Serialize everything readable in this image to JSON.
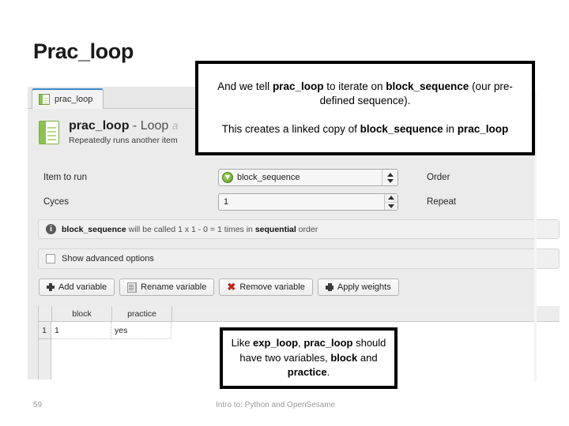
{
  "slide": {
    "title": "Prac_loop",
    "footer_number": "59",
    "footer_text": "Intro to: Python and OpenSesame"
  },
  "panel": {
    "tab": {
      "label": "prac_loop",
      "icon": "spreadsheet-icon"
    },
    "header": {
      "name": "prac_loop",
      "separator": " - ",
      "type": "Loop",
      "hint": "a",
      "description": "Repeatedly runs another item",
      "icon": "loop-spreadsheet-icon"
    },
    "fields": {
      "item_to_run_label": "Item to run",
      "item_to_run_value": "block_sequence",
      "item_to_run_icon": "sequence-icon",
      "order_label": "Order",
      "cycles_label": "Cyces",
      "cycles_value": "1",
      "repeat_label": "Repeat"
    },
    "info": {
      "icon": "info-icon",
      "prefix_bold": "block_sequence",
      "mid": " will be called 1 x 1 - 0 = 1 times in ",
      "order_bold": "sequential",
      "suffix": " order",
      "full_text": "block_sequence will be called 1 x 1 - 0 = 1 times in sequential order"
    },
    "advanced": {
      "checkbox_label": "Show advanced options",
      "checked": false
    },
    "buttons": [
      {
        "label": "Add variable",
        "icon": "plus-icon"
      },
      {
        "label": "Rename variable",
        "icon": "rename-icon"
      },
      {
        "label": "Remove variable",
        "icon": "x-icon"
      },
      {
        "label": "Apply weights",
        "icon": "plus-bold-icon"
      }
    ],
    "table": {
      "columns": [
        "block",
        "practice"
      ],
      "rows": [
        {
          "num": "1",
          "cells": [
            "1",
            "yes"
          ]
        }
      ]
    }
  },
  "callouts": {
    "top": {
      "line1_a": "And we tell ",
      "line1_b": "prac_loop",
      "line1_c": " to iterate on ",
      "line1_d": "block_sequence",
      "line1_e": " (our pre-defined sequence).",
      "line2_a": "This creates a linked copy of ",
      "line2_b": "block_sequence",
      "line2_c": " in ",
      "line2_d": "prac_loop"
    },
    "bottom": {
      "a": "Like ",
      "b": "exp_loop",
      "c": ", ",
      "d": "prac_loop",
      "e": " should have two variables, ",
      "f": "block",
      "g": " and ",
      "h": "practice",
      "i": "."
    }
  },
  "colors": {
    "accent_green": "#8cc152",
    "tab_highlight": "#3d87c8",
    "panel_bg": "#ebebeb",
    "remove_red": "#c0261d"
  }
}
